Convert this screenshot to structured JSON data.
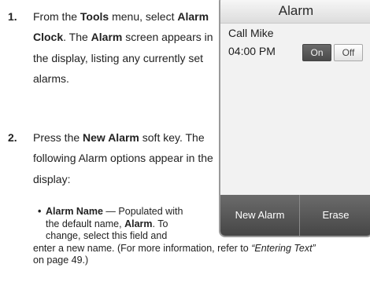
{
  "steps": [
    {
      "number": "1.",
      "parts": [
        "From the ",
        "Tools",
        " menu, select ",
        "Alarm Clock",
        ". The ",
        "Alarm",
        " screen appears in the display, listing any currently set alarms."
      ]
    },
    {
      "number": "2.",
      "parts": [
        "Press the ",
        "New Alarm",
        " soft key. The following Alarm options appear in the display:"
      ]
    }
  ],
  "bullet": {
    "mark": "•",
    "term": "Alarm Name",
    "text_a": " — Populated with",
    "text_b": "the default name, ",
    "term_b": "Alarm",
    "text_c": ". To",
    "text_d": "change, select this field and",
    "text_e": "enter a new name. (For more information, refer to ",
    "ref": "“Entering Text”",
    "text_f": "on page 49.)"
  },
  "phone": {
    "title": "Alarm",
    "alarm": {
      "name": "Call Mike",
      "time": "04:00 PM",
      "on_label": "On",
      "off_label": "Off",
      "state": "On"
    },
    "softkeys": {
      "left": "New Alarm",
      "right": "Erase"
    }
  }
}
